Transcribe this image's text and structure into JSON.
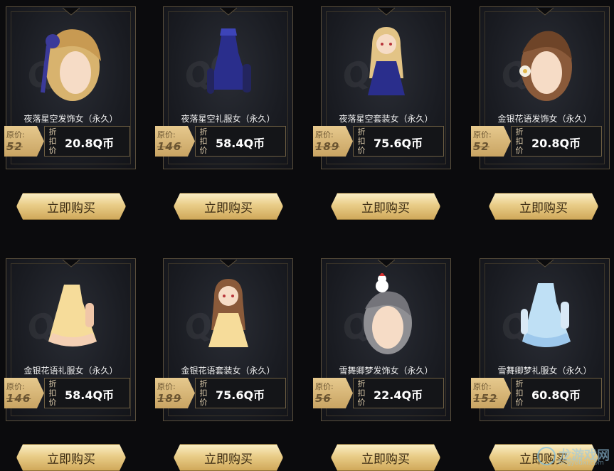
{
  "labels": {
    "original_price": "原价:",
    "discount": "折扣价",
    "buy_button": "立即购买"
  },
  "items": [
    {
      "name": "夜落星空发饰女（永久）",
      "original": "52",
      "price": "20.8Q币",
      "icon": "hair-accessory-icon"
    },
    {
      "name": "夜落星空礼服女（永久）",
      "original": "146",
      "price": "58.4Q币",
      "icon": "dress-icon"
    },
    {
      "name": "夜落星空套装女（永久）",
      "original": "189",
      "price": "75.6Q币",
      "icon": "outfit-set-icon"
    },
    {
      "name": "金银花语发饰女（永久）",
      "original": "52",
      "price": "20.8Q币",
      "icon": "hair-accessory-icon"
    },
    {
      "name": "金银花语礼服女（永久）",
      "original": "146",
      "price": "58.4Q币",
      "icon": "dress-icon"
    },
    {
      "name": "金银花语套装女（永久）",
      "original": "189",
      "price": "75.6Q币",
      "icon": "outfit-set-icon"
    },
    {
      "name": "雪舞卿梦发饰女（永久）",
      "original": "56",
      "price": "22.4Q币",
      "icon": "hair-accessory-icon"
    },
    {
      "name": "雪舞卿梦礼服女（永久）",
      "original": "152",
      "price": "60.8Q币",
      "icon": "dress-icon"
    }
  ],
  "colors": {
    "gold": "#e9cd88",
    "card_border": "#5a4f3c",
    "background": "#0b0b0d"
  },
  "site_watermark": {
    "main": "龙游戏网",
    "sub": "longyouxi.com"
  }
}
